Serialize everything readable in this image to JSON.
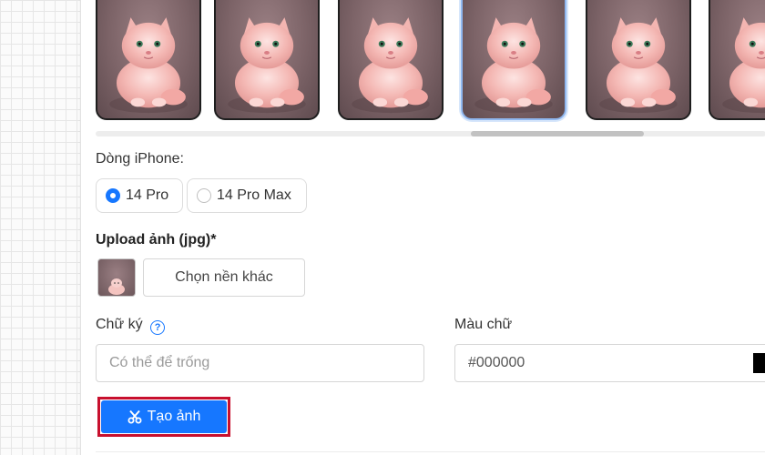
{
  "phone_line": {
    "label": "Dòng iPhone:",
    "options": [
      {
        "label": "14 Pro",
        "selected": true
      },
      {
        "label": "14 Pro Max",
        "selected": false
      }
    ]
  },
  "upload": {
    "label": "Upload ảnh (jpg)*",
    "button_label": "Chọn nền khác"
  },
  "signature": {
    "label": "Chữ ký",
    "help_icon": "question-circle-icon",
    "placeholder": "Có thể để trống"
  },
  "text_color": {
    "label": "Màu chữ",
    "value": "#000000",
    "swatch_color": "#000000"
  },
  "create_button": {
    "label": "Tạo ảnh",
    "icon": "scissors-icon"
  },
  "thumbnails": {
    "count": 6,
    "selected_index": 3,
    "subject": "fluffy-pink-cat"
  },
  "colors": {
    "accent": "#1677ff",
    "highlight_outline": "#c8102e",
    "selected_thumb_border": "#8fb7ef"
  }
}
